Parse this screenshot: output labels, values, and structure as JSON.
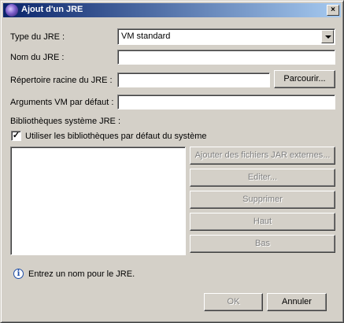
{
  "window": {
    "title": "Ajout d'un JRE",
    "close_glyph": "×"
  },
  "form": {
    "jre_type_label": "Type du JRE :",
    "jre_type_value": "VM standard",
    "jre_name_label": "Nom du JRE :",
    "jre_name_value": "",
    "jre_home_label": "Répertoire racine du JRE :",
    "jre_home_value": "",
    "browse_label": "Parcourir...",
    "vm_args_label": "Arguments VM par défaut :",
    "vm_args_value": "",
    "system_libraries_label": "Bibliothèques système JRE :",
    "use_default_libraries_label": "Utiliser les bibliothèques par défaut du système",
    "use_default_libraries_checked": true,
    "check_glyph": "✓"
  },
  "library_buttons": {
    "add_external_jars": "Ajouter des fichiers JAR externes...",
    "edit": "Editer...",
    "remove": "Supprimer",
    "up": "Haut",
    "down": "Bas"
  },
  "status": {
    "icon": "info-icon",
    "icon_glyph": "i",
    "message": "Entrez un nom pour le JRE."
  },
  "footer": {
    "ok_label": "OK",
    "cancel_label": "Annuler"
  }
}
